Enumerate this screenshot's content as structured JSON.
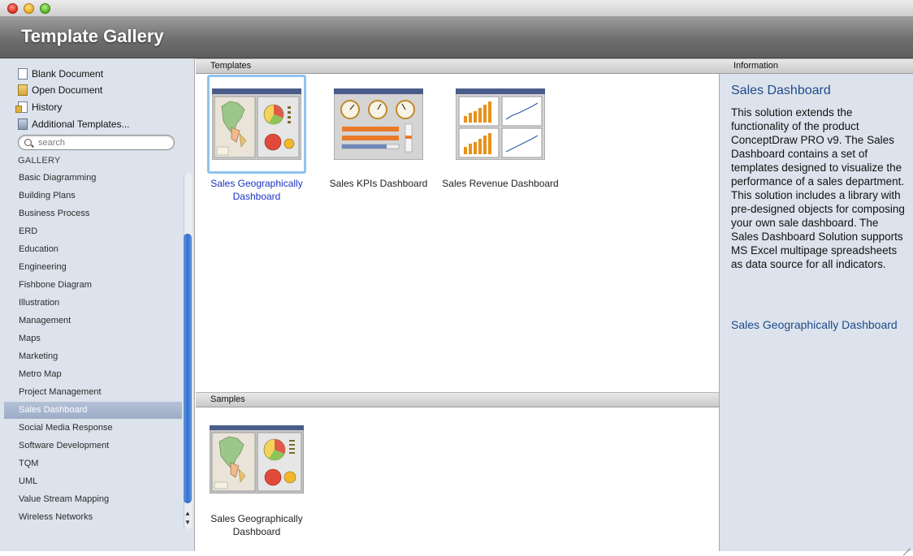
{
  "window": {
    "title": "Template Gallery"
  },
  "sidebar": {
    "actions": [
      {
        "label": "Blank Document",
        "icon": "blank-document-icon"
      },
      {
        "label": "Open Document",
        "icon": "open-document-icon"
      },
      {
        "label": "History",
        "icon": "history-icon"
      },
      {
        "label": "Additional Templates...",
        "icon": "download-icon"
      }
    ],
    "search": {
      "placeholder": "search",
      "value": ""
    },
    "gallery_header": "GALLERY",
    "categories": [
      "Basic Diagramming",
      "Building Plans",
      "Business Process",
      "ERD",
      "Education",
      "Engineering",
      "Fishbone Diagram",
      "Illustration",
      "Management",
      "Maps",
      "Marketing",
      "Metro Map",
      "Project Management",
      "Sales Dashboard",
      "Social Media Response",
      "Software Development",
      "TQM",
      "UML",
      "Value Stream Mapping",
      "Wireless Networks"
    ],
    "selected_category": "Sales Dashboard"
  },
  "templates_section": {
    "header": "Templates",
    "items": [
      {
        "label": "Sales Geographically Dashboard",
        "selected": true
      },
      {
        "label": "Sales KPIs Dashboard",
        "selected": false
      },
      {
        "label": "Sales Revenue Dashboard",
        "selected": false
      }
    ]
  },
  "samples_section": {
    "header": "Samples",
    "items": [
      {
        "label": "Sales Geographically Dashboard"
      }
    ]
  },
  "info_panel": {
    "header": "Information",
    "title": "Sales Dashboard",
    "description": "This solution extends the functionality of the product ConceptDraw PRO v9. The Sales Dashboard contains a set of templates designed to visualize the performance of a sales department. This solution includes a library with pre-designed objects for composing your own sale dashboard. The Sales Dashboard Solution supports MS Excel multipage spreadsheets as data source for all indicators.",
    "link": "Sales Geographically Dashboard"
  },
  "colors": {
    "selection_blue": "#1a33c4",
    "info_title": "#1e4a8a",
    "sidebar_bg": "#dde3ec",
    "selected_row": "#a9b7ce"
  }
}
